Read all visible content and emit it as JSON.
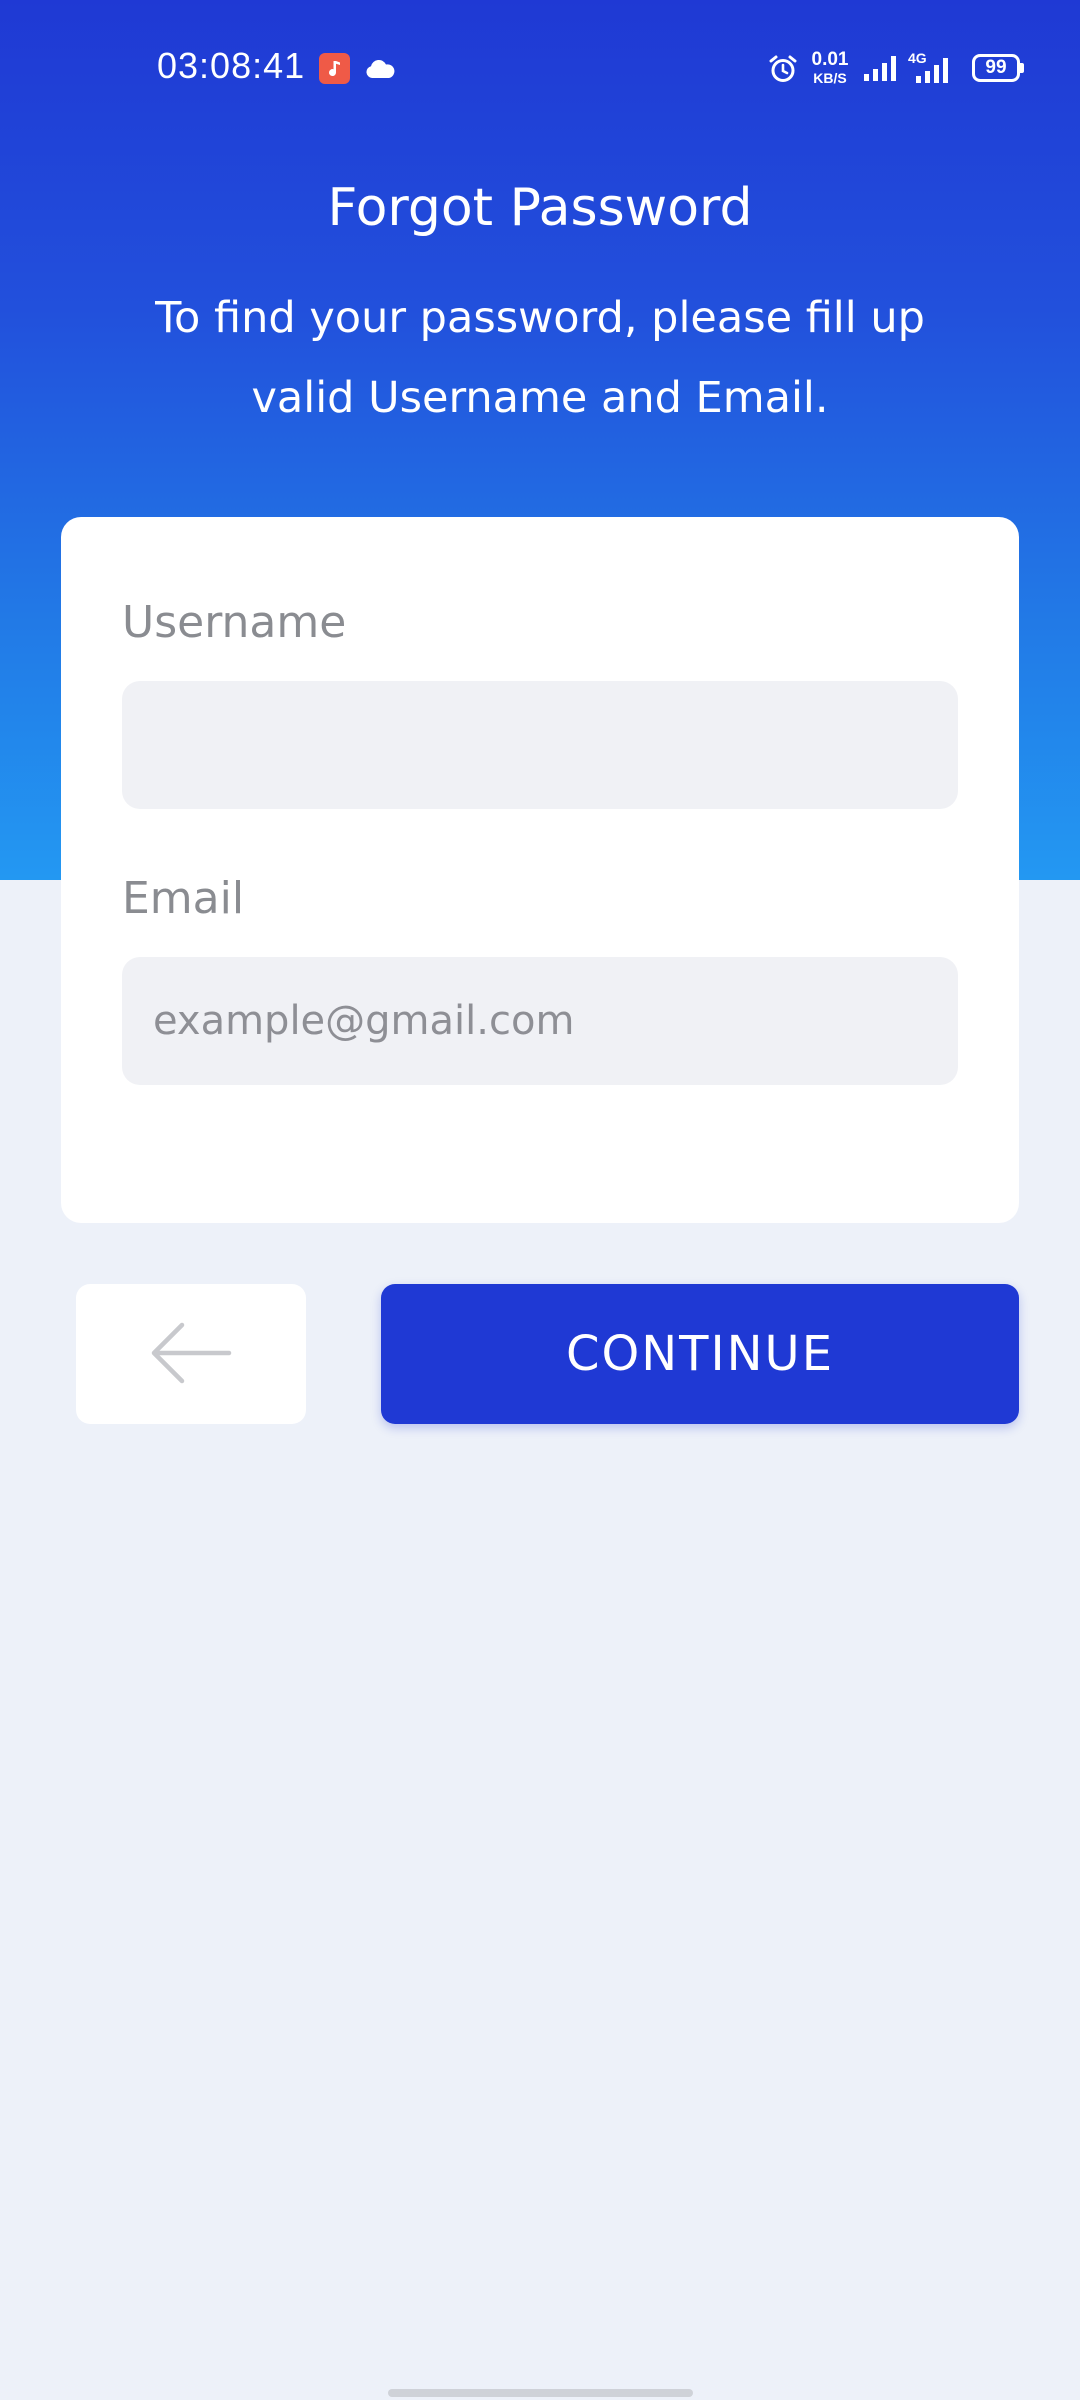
{
  "status_bar": {
    "time": "03:08:41",
    "net_speed_value": "0.01",
    "net_speed_unit": "KB/S",
    "network_type": "4G",
    "battery": "99",
    "icons": [
      "music-app-icon",
      "cloud-icon",
      "alarm-icon",
      "signal-icon",
      "signal-4g-icon",
      "battery-icon"
    ]
  },
  "header": {
    "title": "Forgot Password",
    "subtitle": "To find your password, please fill up valid Username and Email."
  },
  "form": {
    "username_label": "Username",
    "username_value": "",
    "email_label": "Email",
    "email_placeholder": "example@gmail.com",
    "email_value": ""
  },
  "actions": {
    "back_icon": "arrow-left-icon",
    "continue_label": "CONTINUE"
  },
  "colors": {
    "primary": "#1f39d4",
    "hero_gradient_end": "#2398f2",
    "background": "#edf1f9",
    "input_bg": "#f0f1f5",
    "label": "#8a8c91"
  }
}
